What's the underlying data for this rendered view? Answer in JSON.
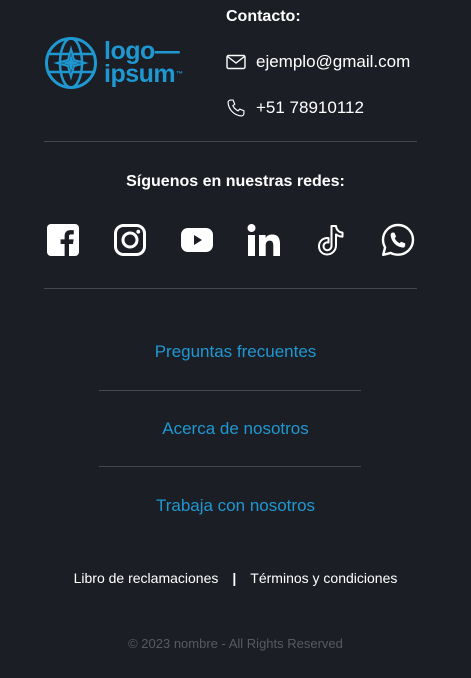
{
  "brand": {
    "logo_line1": "logo—",
    "logo_line2": "ipsum",
    "logo_tm": "™",
    "accent_color": "#1f98d1"
  },
  "contact": {
    "title": "Contacto:",
    "email": "ejemplo@gmail.com",
    "phone": "+51 78910112",
    "email_icon": "mail-icon",
    "phone_icon": "phone-icon"
  },
  "social": {
    "title": "Síguenos en nuestras redes:",
    "networks": [
      "facebook-icon",
      "instagram-icon",
      "youtube-icon",
      "linkedin-icon",
      "tiktok-icon",
      "whatsapp-icon"
    ]
  },
  "links": {
    "faq": "Preguntas frecuentes",
    "about": "Acerca de nosotros",
    "jobs": "Trabaja con nosotros"
  },
  "legal": {
    "complaints": "Libro de reclamaciones",
    "separator": "|",
    "terms": "Términos y condiciones"
  },
  "footer": {
    "copyright": "© 2023 nombre - All Rights Reserved"
  }
}
